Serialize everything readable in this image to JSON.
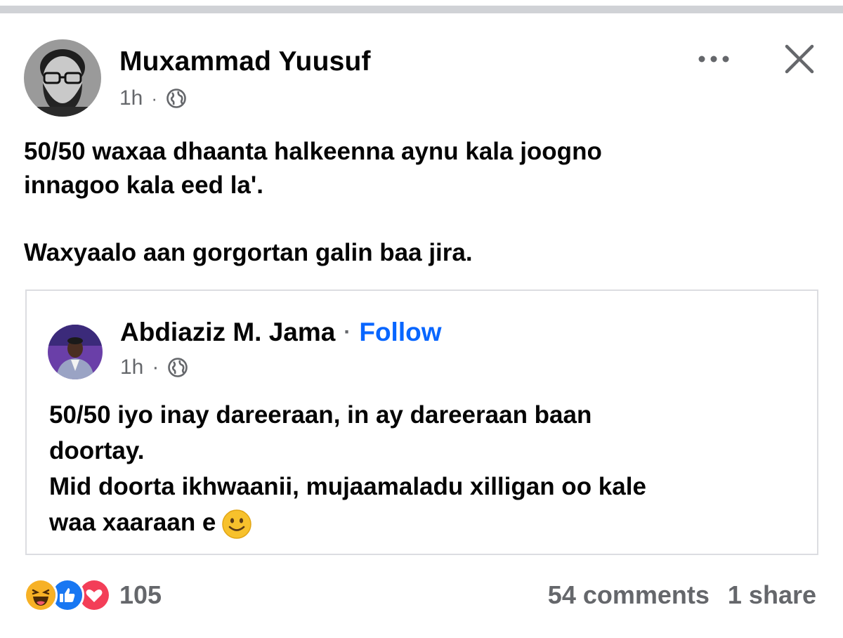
{
  "post": {
    "author": "Muxammad Yuusuf",
    "time": "1h",
    "separator": "·",
    "text_line1": "50/50 waxaa dhaanta halkeenna aynu kala joogno",
    "text_line2": "innagoo kala eed la'.",
    "text_line3": "Waxyaalo aan gorgortan galin baa jira."
  },
  "shared": {
    "author": "Abdiaziz M. Jama",
    "separator": "·",
    "follow_label": "Follow",
    "time": "1h",
    "text_line1": "50/50 iyo inay dareeraan, in ay dareeraan baan",
    "text_line2": "doortay.",
    "text_line3": "Mid doorta ikhwaanii, mujaamaladu xilligan oo kale",
    "text_line4": "waa xaaraan e"
  },
  "footer": {
    "reaction_count": "105",
    "comments": "54 comments",
    "shares": "1 share"
  },
  "colors": {
    "accent": "#0866ff",
    "muted": "#65676b",
    "border": "#dcdde1",
    "like": "#1877f2",
    "love": "#f33e58",
    "haha": "#f7b125"
  },
  "icons": [
    "globe-icon",
    "more-icon",
    "close-icon",
    "haha-icon",
    "like-icon",
    "love-icon",
    "smile-emoji-icon"
  ]
}
